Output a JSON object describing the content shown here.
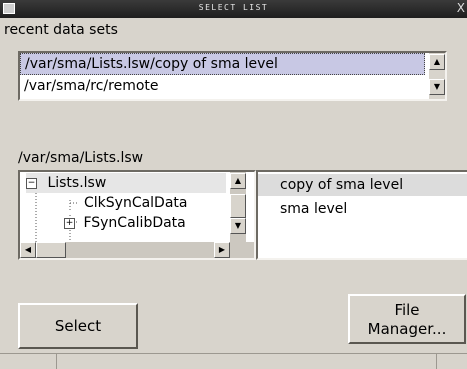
{
  "window": {
    "title": "SELECT LIST",
    "close_glyph": "X"
  },
  "recent": {
    "label": "recent data sets",
    "items": [
      "/var/sma/Lists.lsw/copy of sma level",
      "/var/sma/rc/remote"
    ]
  },
  "directory": {
    "path": "/var/sma/Lists.lsw"
  },
  "tree": {
    "items": [
      {
        "label": "Lists.lsw",
        "toggle": "−"
      },
      {
        "label": "ClkSynCalData"
      },
      {
        "label": "FSynCalibData",
        "toggle": "+"
      }
    ]
  },
  "files": {
    "items": [
      "copy of sma level",
      "sma level"
    ]
  },
  "buttons": {
    "select": "Select",
    "file_manager_line1": "File",
    "file_manager_line2": "Manager..."
  },
  "colors": {
    "selection": "#c8c8e4",
    "background": "#d8d4cc"
  }
}
